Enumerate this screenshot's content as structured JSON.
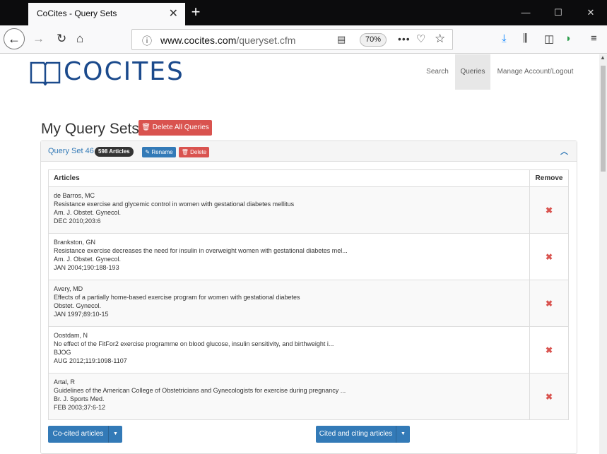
{
  "browser": {
    "tab_title": "CoCites - Query Sets",
    "tab_close": "✕",
    "new_tab": "+",
    "window_controls": {
      "minimize": "—",
      "maximize": "☐",
      "close": "✕"
    },
    "url_domain": "www.cocites.com",
    "url_path": "/queryset.cfm",
    "zoom": "70%",
    "icons": [
      "back-arrow-icon",
      "forward-arrow-icon",
      "reload-icon",
      "home-icon",
      "info-icon",
      "reader-view-icon",
      "page-actions-icon",
      "pocket-icon",
      "bookmark-star-icon",
      "download-icon",
      "library-icon",
      "sidebar-icon",
      "extension-icon",
      "menu-icon"
    ]
  },
  "site": {
    "logo_text": "COCITES",
    "nav": [
      {
        "label": "Search"
      },
      {
        "label": "Queries"
      },
      {
        "label": "Manage Account/Logout"
      }
    ],
    "accent": "#1b4a8c"
  },
  "main": {
    "title": "My Query Sets",
    "delete_all_label": "Delete All Queries",
    "query_set": {
      "title": "Query Set 46",
      "badge": "598 Articles",
      "rename_label": "Rename",
      "delete_label": "Delete",
      "table": {
        "col_articles": "Articles",
        "col_remove": "Remove",
        "rows": [
          {
            "author": "de Barros, MC",
            "title": "Resistance exercise and glycemic control in women with gestational diabetes mellitus",
            "journal": "Am. J. Obstet. Gynecol.",
            "citation": "DEC 2010;203:6"
          },
          {
            "author": "Brankston, GN",
            "title": "Resistance exercise decreases the need for insulin in overweight women with gestational diabetes mel...",
            "journal": "Am. J. Obstet. Gynecol.",
            "citation": "JAN 2004;190:188-193"
          },
          {
            "author": "Avery, MD",
            "title": "Effects of a partially home-based exercise program for women with gestational diabetes",
            "journal": "Obstet. Gynecol.",
            "citation": "JAN 1997;89:10-15"
          },
          {
            "author": "Oostdam, N",
            "title": "No effect of the FitFor2 exercise programme on blood glucose, insulin sensitivity, and birthweight i...",
            "journal": "BJOG",
            "citation": "AUG 2012;119:1098-1107"
          },
          {
            "author": "Artal, R",
            "title": "Guidelines of the American College of Obstetricians and Gynecologists for exercise during pregnancy ...",
            "journal": "Br. J. Sports Med.",
            "citation": "FEB 2003;37:6-12"
          }
        ]
      },
      "cocited_label": "Co-cited articles",
      "cited_citing_label": "Cited and citing articles"
    }
  },
  "colors": {
    "danger": "#d9534f",
    "primary": "#337ab7"
  }
}
